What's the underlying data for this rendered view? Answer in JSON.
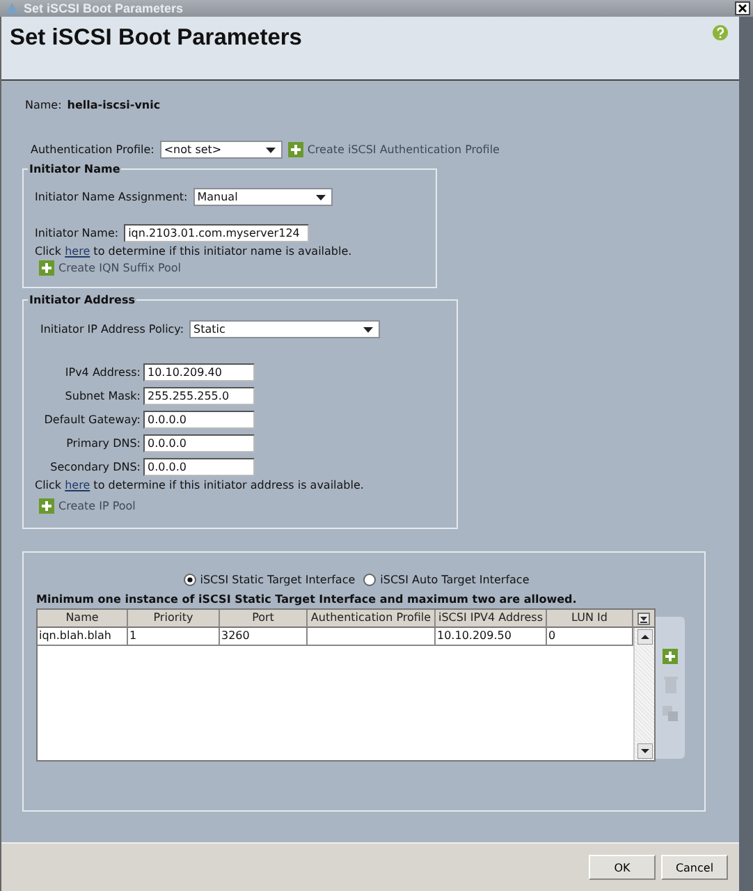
{
  "window": {
    "title": "Set iSCSI Boot Parameters"
  },
  "header": {
    "title": "Set iSCSI Boot Parameters"
  },
  "name": {
    "label": "Name:",
    "value": "hella-iscsi-vnic"
  },
  "auth_profile": {
    "label": "Authentication Profile:",
    "value": "<not set>",
    "create_link": "Create iSCSI Authentication Profile"
  },
  "initiator_name": {
    "legend": "Initiator Name",
    "assignment": {
      "label": "Initiator Name Assignment:",
      "value": "Manual"
    },
    "name_field": {
      "label": "Initiator Name:",
      "value": "iqn.2103.01.com.myserver124"
    },
    "check": {
      "before": "Click",
      "link": "here",
      "after": "to determine if this initiator name is available."
    },
    "create_link": "Create IQN Suffix Pool"
  },
  "initiator_address": {
    "legend": "Initiator Address",
    "policy": {
      "label": "Initiator IP Address Policy:",
      "value": "Static"
    },
    "fields": [
      {
        "label": "IPv4 Address:",
        "value": "10.10.209.40"
      },
      {
        "label": "Subnet Mask:",
        "value": "255.255.255.0"
      },
      {
        "label": "Default Gateway:",
        "value": "0.0.0.0"
      },
      {
        "label": "Primary DNS:",
        "value": "0.0.0.0"
      },
      {
        "label": "Secondary DNS:",
        "value": "0.0.0.0"
      }
    ],
    "check": {
      "before": "Click",
      "link": "here",
      "after": "to determine if this initiator address is available."
    },
    "create_link": "Create IP Pool"
  },
  "targets": {
    "options": [
      {
        "label": "iSCSI Static Target Interface",
        "selected": true
      },
      {
        "label": "iSCSI Auto Target Interface",
        "selected": false
      }
    ],
    "note": "Minimum one instance of iSCSI Static Target Interface and maximum two are allowed.",
    "table": {
      "columns": [
        "Name",
        "Priority",
        "Port",
        "Authentication Profile",
        "iSCSI IPV4 Address",
        "LUN Id"
      ],
      "rows": [
        [
          "iqn.blah.blah",
          "1",
          "3260",
          "",
          "10.10.209.50",
          "0"
        ]
      ]
    }
  },
  "buttons": [
    "OK",
    "Cancel"
  ]
}
